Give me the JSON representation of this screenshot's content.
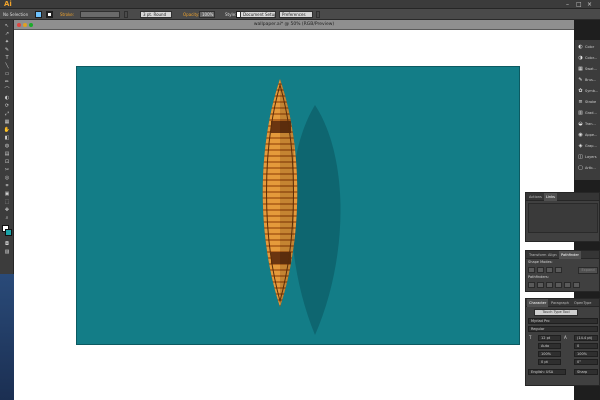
{
  "app": {
    "logo": "Ai",
    "document_title": "wallpaper.ai* @ 50% (RGB/Preview)",
    "window_controls": [
      "–",
      "□",
      "×"
    ]
  },
  "control_bar": {
    "selection_status": "No Selection",
    "stroke_label": "Stroke:",
    "stroke_weight": "",
    "brush": "3 pt. Round",
    "opacity_label": "Opacity:",
    "opacity_value": "100%",
    "style_label": "Style:",
    "document_setup": "Document Setup",
    "preferences": "Preferences"
  },
  "tools": [
    "↖",
    "↗",
    "✦",
    "✎",
    "T",
    "╲",
    "▭",
    "✏",
    "⌒",
    "◐",
    "⟳",
    "⤢",
    "▦",
    "✋",
    "◧",
    "◍",
    "▤",
    "⊡",
    "✂",
    "◎",
    "⌗",
    "▣",
    "⬚",
    "✥",
    "⊕",
    "⊖",
    "✋",
    "⌕",
    "◘",
    "▨"
  ],
  "dock": {
    "items": [
      {
        "label": "Color",
        "icon": "color-icon",
        "glyph": "◐"
      },
      {
        "label": "Color...",
        "icon": "color-guide-icon",
        "glyph": "◑"
      },
      {
        "label": "Swat...",
        "icon": "swatches-icon",
        "glyph": "▦"
      },
      {
        "label": "Brus...",
        "icon": "brushes-icon",
        "glyph": "✎"
      },
      {
        "label": "Symb...",
        "icon": "symbols-icon",
        "glyph": "✿"
      },
      {
        "label": "Stroke",
        "icon": "stroke-icon",
        "glyph": "≡"
      },
      {
        "label": "Grad...",
        "icon": "gradient-icon",
        "glyph": "▥"
      },
      {
        "label": "Tran...",
        "icon": "transparency-icon",
        "glyph": "◒"
      },
      {
        "label": "Appe...",
        "icon": "appearance-icon",
        "glyph": "◉"
      },
      {
        "label": "Grap...",
        "icon": "graphic-styles-icon",
        "glyph": "◈"
      },
      {
        "label": "Layers",
        "icon": "layers-icon",
        "glyph": "◫"
      },
      {
        "label": "Artb...",
        "icon": "artboards-icon",
        "glyph": "▢"
      }
    ]
  },
  "actions_panel": {
    "tabs": [
      "Actions",
      "Links"
    ]
  },
  "pathfinder_panel": {
    "tabs": [
      "Transform",
      "Align",
      "Pathfinder"
    ],
    "shape_modes": "Shape Modes:",
    "pathfinders": "Pathfinders:",
    "expand": "Expand"
  },
  "character_panel": {
    "tabs": [
      "Character",
      "Paragraph",
      "OpenType"
    ],
    "touch_type": "Touch Type Tool",
    "font_family": "Myriad Pro",
    "font_style": "Regular",
    "font_size": "12 pt",
    "leading": "(14.4 pt)",
    "kerning": "Auto",
    "tracking": "0",
    "h_scale": "100%",
    "v_scale": "100%",
    "baseline": "0 pt",
    "rotation": "0°",
    "language": "English: USA",
    "antialias": "Sharp"
  },
  "colors": {
    "artboard": "#137d87",
    "shadow": "#0e6670",
    "canoe_outer": "#8a4b12",
    "canoe_plank_a": "#e59a3b",
    "canoe_plank_b": "#b8691f",
    "seat": "#6b3510",
    "ui_panel": "#404040",
    "accent": "#f0a32b"
  }
}
